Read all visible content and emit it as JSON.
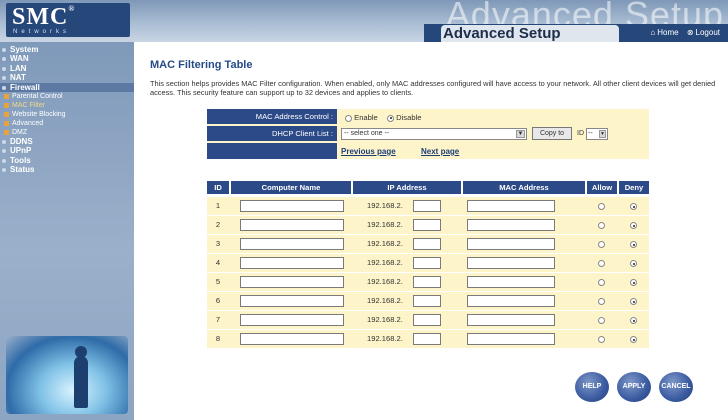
{
  "header": {
    "logo": "SMC",
    "logo_reg": "®",
    "logo_sub": "Networks",
    "ghost_title": "Advanced Setup",
    "tab_label": "Advanced Setup",
    "home_link": "Home",
    "logout_link": "Logout"
  },
  "sidebar": {
    "items": [
      {
        "label": "System"
      },
      {
        "label": "WAN"
      },
      {
        "label": "LAN"
      },
      {
        "label": "NAT"
      },
      {
        "label": "Firewall"
      }
    ],
    "sub_items": [
      {
        "label": "Parental Control"
      },
      {
        "label": "MAC Filter"
      },
      {
        "label": "Website Blocking"
      },
      {
        "label": "Advanced"
      },
      {
        "label": "DMZ"
      }
    ],
    "items_after": [
      {
        "label": "DDNS"
      },
      {
        "label": "UPnP"
      },
      {
        "label": "Tools"
      },
      {
        "label": "Status"
      }
    ]
  },
  "page": {
    "title": "MAC Filtering Table",
    "description": "This section helps provides MAC Filter configuration. When enabled, only MAC addresses configured will have access to your network. All other client devices will get denied access. This security feature can support up to 32 devices and applies to clients."
  },
  "control": {
    "mac_label": "MAC Address Control :",
    "enable": "Enable",
    "disable": "Disable",
    "selected": "disable",
    "dhcp_label": "DHCP Client List :",
    "select_value": "-- select one --",
    "copy_to": "Copy to",
    "id_label": "ID",
    "id_value": "--",
    "prev": "Previous page",
    "next": "Next page"
  },
  "table": {
    "headers": {
      "id": "ID",
      "computer": "Computer Name",
      "ip": "IP Address",
      "mac": "MAC Address",
      "allow": "Allow",
      "deny": "Deny"
    },
    "ip_prefix": "192.168.2.",
    "rows": [
      {
        "id": "1",
        "selected": "deny"
      },
      {
        "id": "2",
        "selected": "deny"
      },
      {
        "id": "3",
        "selected": "deny"
      },
      {
        "id": "4",
        "selected": "deny"
      },
      {
        "id": "5",
        "selected": "deny"
      },
      {
        "id": "6",
        "selected": "deny"
      },
      {
        "id": "7",
        "selected": "deny"
      },
      {
        "id": "8",
        "selected": "deny"
      }
    ]
  },
  "buttons": {
    "help": "HELP",
    "apply": "APPLY",
    "cancel": "CANCEL"
  },
  "colors": {
    "header_blue": "#2d4a88",
    "cell_yellow": "#fdf4c9",
    "title_blue": "#254b88"
  }
}
